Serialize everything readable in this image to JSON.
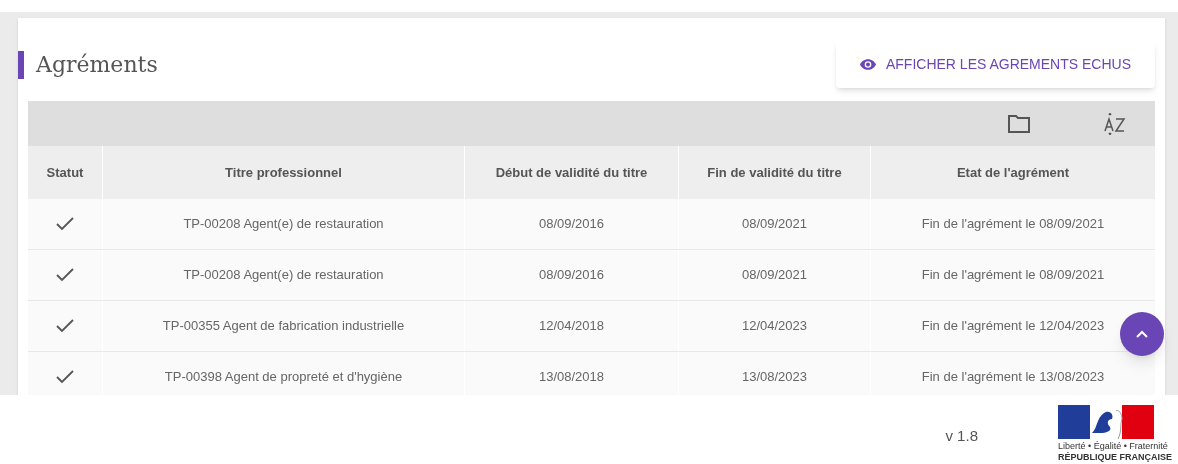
{
  "card": {
    "title": "Agréments",
    "action_button": "AFFICHER LES AGREMENTS ECHUS"
  },
  "table": {
    "columns": [
      "Statut",
      "Titre professionnel",
      "Début de validité du titre",
      "Fin de validité du titre",
      "Etat de l'agrément"
    ],
    "rows": [
      {
        "checked": true,
        "title": "TP-00208 Agent(e) de restauration",
        "start": "08/09/2016",
        "end": "08/09/2021",
        "state": "Fin de l'agrément le 08/09/2021"
      },
      {
        "checked": true,
        "title": "TP-00208 Agent(e) de restauration",
        "start": "08/09/2016",
        "end": "08/09/2021",
        "state": "Fin de l'agrément le 08/09/2021"
      },
      {
        "checked": true,
        "title": "TP-00355 Agent de fabrication industrielle",
        "start": "12/04/2018",
        "end": "12/04/2023",
        "state": "Fin de l'agrément le 12/04/2023"
      },
      {
        "checked": true,
        "title": "TP-00398 Agent de propreté et d'hygiène",
        "start": "13/08/2018",
        "end": "13/08/2023",
        "state": "Fin de l'agrément le 13/08/2023"
      }
    ]
  },
  "footer": {
    "version": "v 1.8",
    "logo_motto": "Liberté • Égalité • Fraternité",
    "logo_name": "RÉPUBLIQUE FRANÇAISE"
  }
}
